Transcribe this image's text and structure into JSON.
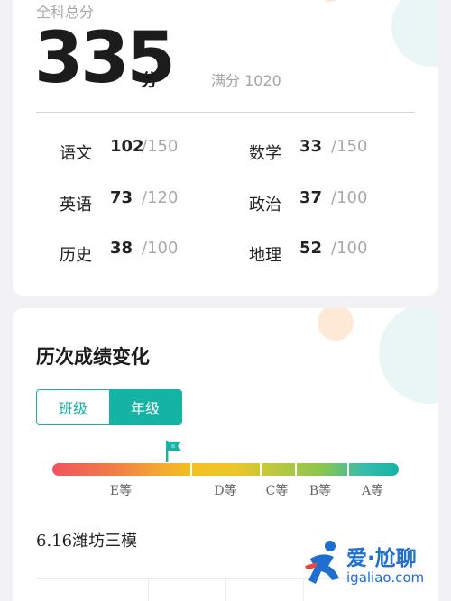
{
  "total": {
    "label": "全科总分",
    "score": "335",
    "unit": "分",
    "full_mark": "满分 1020"
  },
  "subjects": [
    {
      "name": "语文",
      "score": "102",
      "max": "/150"
    },
    {
      "name": "数学",
      "score": "33",
      "max": "/150"
    },
    {
      "name": "英语",
      "score": "73",
      "max": "/120"
    },
    {
      "name": "政治",
      "score": "37",
      "max": "/100"
    },
    {
      "name": "历史",
      "score": "38",
      "max": "/100"
    },
    {
      "name": "地理",
      "score": "52",
      "max": "/100"
    }
  ],
  "history": {
    "title": "历次成绩变化",
    "tabs": [
      {
        "label": "班级",
        "active": false
      },
      {
        "label": "年级",
        "active": true
      }
    ],
    "grade_levels": [
      "E等",
      "D等",
      "C等",
      "B等",
      "A等"
    ],
    "current_level_fraction": 0.33,
    "exam_name": "6.16潍坊三模"
  },
  "watermark": {
    "text": "爱·尬聊",
    "url": "igaliao.com"
  },
  "colors": {
    "accent": "#15b3a4",
    "bar_start": "#ef5361",
    "bar_mid": "#f2c021",
    "bar_end": "#15b3a4",
    "deco_teal": "#e6f5f4",
    "deco_orange": "#fde9d6",
    "watermark": "#1f6fd1",
    "watermark_red": "#e9443f"
  },
  "icons": {
    "flag": "flag-icon",
    "watermark_logo": "runner-logo-icon"
  }
}
